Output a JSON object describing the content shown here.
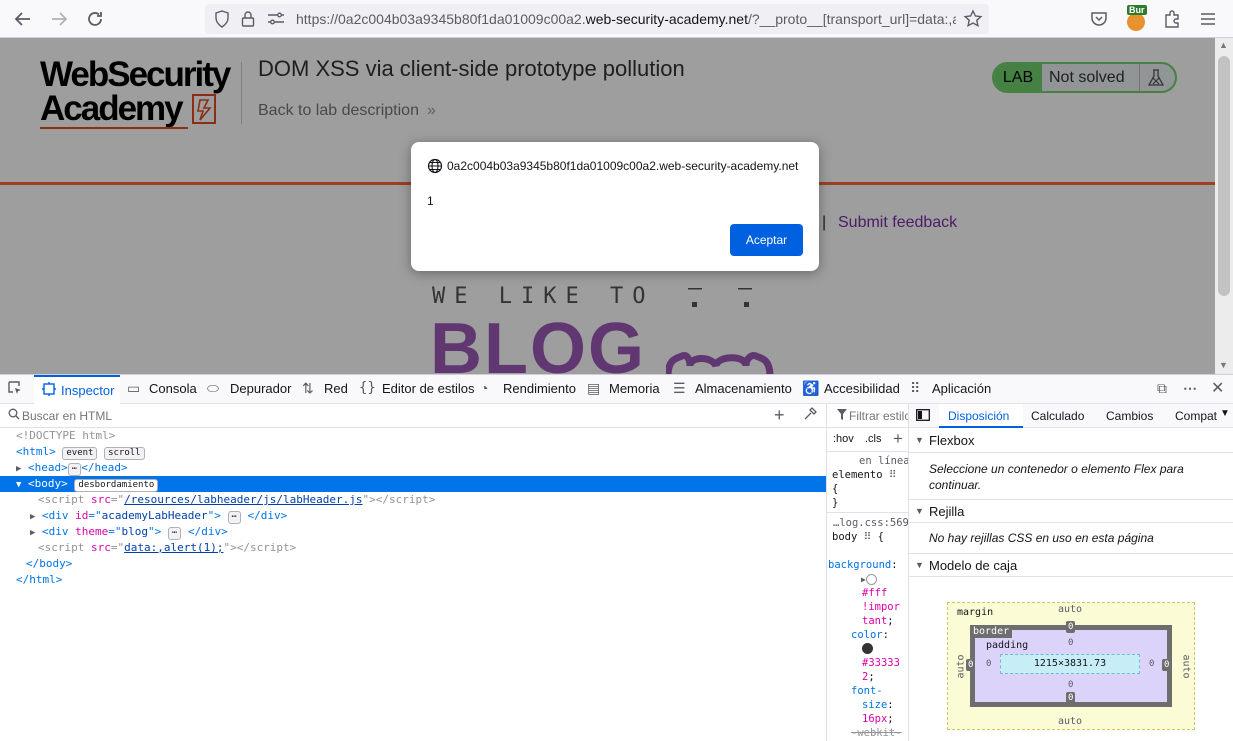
{
  "browser": {
    "url_prefix": "https://0a2c004b03a9345b80f1da01009c00a2.",
    "url_domain": "web-security-academy.net",
    "url_suffix": "/?__proto__[transport_url]=data:,al",
    "profile_badge": "Bur"
  },
  "page": {
    "logo_line1": "WebSecurity",
    "logo_line2": "Academy",
    "lab_title": "DOM XSS via client-side prototype pollution",
    "back_link": "Back to lab description",
    "lab_badge": "LAB",
    "lab_status": "Not solved",
    "nav_separator": "|",
    "submit_feedback": "Submit feedback",
    "blog_tagline": "WE LIKE TO",
    "blog_word": "BLOG"
  },
  "dialog": {
    "origin": "0a2c004b03a9345b80f1da01009c00a2.web-security-academy.net",
    "message": "1",
    "accept_label": "Aceptar"
  },
  "devtools": {
    "tabs": [
      "Inspector",
      "Consola",
      "Depurador",
      "Red",
      "Editor de estilos",
      "Rendimiento",
      "Memoria",
      "Almacenamiento",
      "Accesibilidad",
      "Aplicación"
    ],
    "search_placeholder": "Buscar en HTML",
    "filter_placeholder": "Filtrar estilo",
    "hov": ":hov",
    "cls": ".cls",
    "tree": {
      "doctype": "<!DOCTYPE html>",
      "html_open": "<html>",
      "badge_event": "event",
      "badge_scroll": "scroll",
      "head": "<head>",
      "head_close": "</head>",
      "body_open": "<body>",
      "badge_overflow": "desbordamiento",
      "ellipsis": "⋯",
      "script1_src": "/resources/labheader/js/labHeader.js",
      "div1_id": "academyLabHeader",
      "div2_theme": "blog",
      "script2_src": "data:,alert(1);",
      "body_close": "</body>",
      "html_close": "</html>"
    },
    "rules": {
      "inline_label": "en línea",
      "element_label": "elemento",
      "brace_open": "{",
      "brace_close": "}",
      "source": "…log.css:569",
      "selector": "body",
      "prop_background": "background",
      "val_bg": "#fff",
      "val_important": "!impor",
      "val_important2": "tant",
      "prop_color": "color",
      "val_color": "#33333",
      "val_color2": "2",
      "prop_font": "font-",
      "prop_font2": "size",
      "val_font": "16px",
      "prop_webkit": "-webkit-"
    },
    "layout_tabs": [
      "Disposición",
      "Calculado",
      "Cambios",
      "Compat"
    ],
    "flexbox": {
      "title": "Flexbox",
      "text": "Seleccione un contenedor o elemento Flex para continuar."
    },
    "grid": {
      "title": "Rejilla",
      "text": "No hay rejillas CSS en uso en esta página"
    },
    "box_model": {
      "title": "Modelo de caja",
      "margin_label": "margin",
      "border_label": "border",
      "padding_label": "padding",
      "margin_top": "auto",
      "margin_bottom": "auto",
      "margin_left": "auto",
      "margin_right": "auto",
      "border_top": "0",
      "border_bottom": "0",
      "border_left": "0",
      "border_right": "0",
      "padding_top": "0",
      "padding_bottom": "0",
      "padding_left": "0",
      "padding_right": "0",
      "content_size": "1215×3831.73"
    }
  }
}
